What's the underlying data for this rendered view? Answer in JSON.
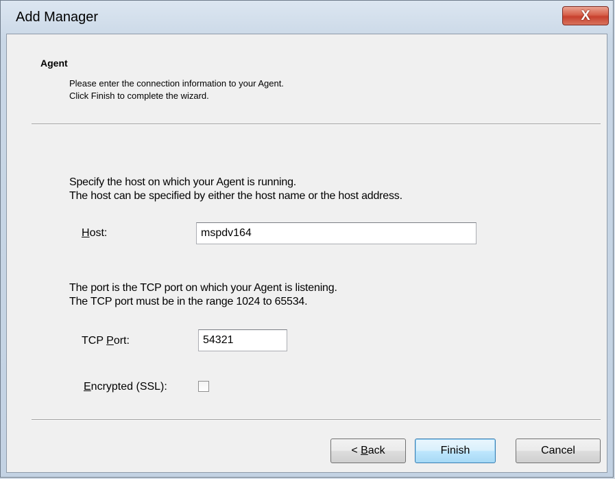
{
  "window": {
    "title": "Add Manager",
    "close_glyph": "X"
  },
  "header": {
    "title": "Agent",
    "line1": "Please enter the connection information to your Agent.",
    "line2": "Click Finish to complete the wizard."
  },
  "host_section": {
    "line1": "Specify the host on which your Agent is running.",
    "line2": "The host can be specified by either the host name or the host address.",
    "label_mnemonic": "H",
    "label_rest": "ost:",
    "value": "mspdv164"
  },
  "port_section": {
    "line1": "The port is the TCP port on which your Agent is listening.",
    "line2": "The TCP port must be in the range 1024 to 65534.",
    "label_prefix": "TCP ",
    "label_mnemonic": "P",
    "label_rest": "ort:",
    "value": "54321"
  },
  "ssl": {
    "label_mnemonic": "E",
    "label_rest": "ncrypted (SSL):",
    "checked": false
  },
  "buttons": {
    "back_prefix": "< ",
    "back_mnemonic": "B",
    "back_rest": "ack",
    "finish": "Finish",
    "cancel": "Cancel"
  },
  "colors": {
    "close_button": "#c7412e",
    "default_button_border": "#3c7fb1"
  }
}
